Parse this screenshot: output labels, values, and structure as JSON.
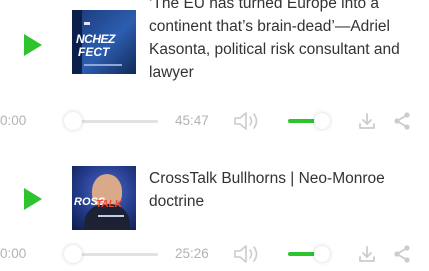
{
  "colors": {
    "accent": "#2ec42e",
    "text": "#333333",
    "muted": "#b3b3b3",
    "icon": "#cccccc",
    "track": "#e2e2e2"
  },
  "episodes": [
    {
      "title": "‘The EU has turned Europe into a continent that’s brain-dead’—Adriel Kasonta, political risk consultant and lawyer",
      "artwork_text": [
        "NCHEZ",
        "FECT"
      ],
      "current_time": "0:00",
      "duration": "45:47",
      "progress": 0.0,
      "volume": 0.7,
      "icons": [
        "play-icon",
        "volume-icon",
        "download-icon",
        "share-icon"
      ]
    },
    {
      "title": "CrossTalk Bullhorns | Neo-Monroe doctrine",
      "artwork_text": [
        "ROSS",
        "TALK"
      ],
      "current_time": "0:00",
      "duration": "25:26",
      "progress": 0.0,
      "volume": 0.7,
      "icons": [
        "play-icon",
        "volume-icon",
        "download-icon",
        "share-icon"
      ]
    }
  ]
}
